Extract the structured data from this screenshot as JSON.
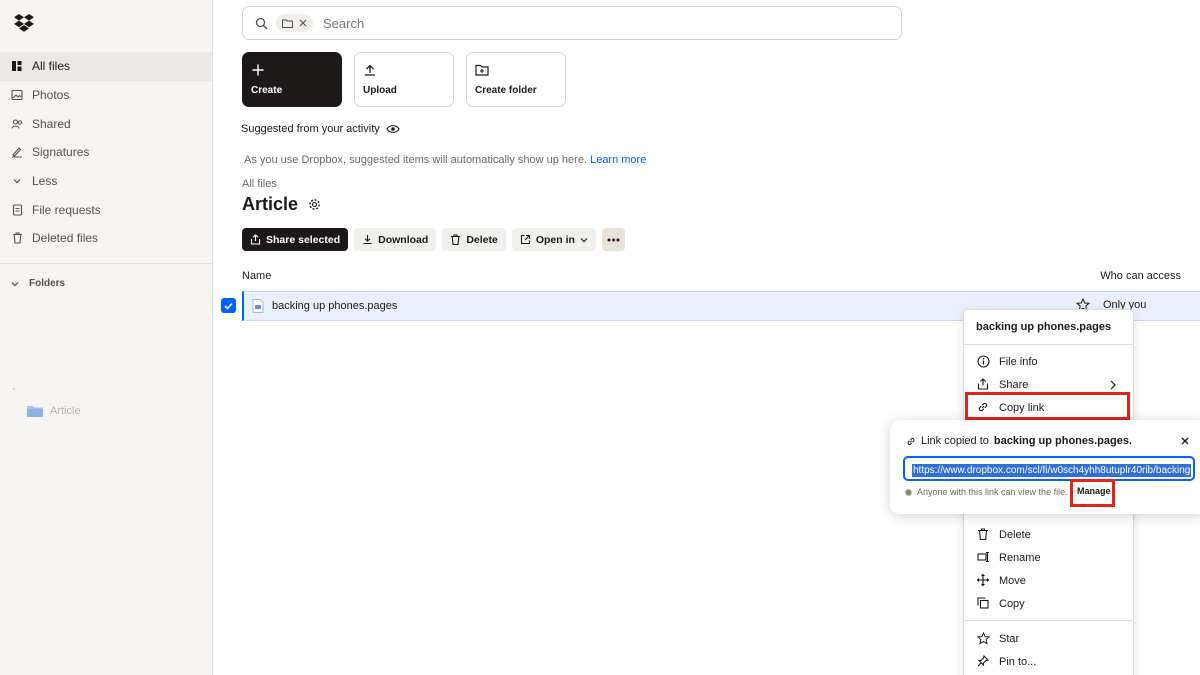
{
  "sidebar": {
    "items": [
      {
        "label": "All files",
        "icon": "all-files-icon"
      },
      {
        "label": "Photos",
        "icon": "photos-icon"
      },
      {
        "label": "Shared",
        "icon": "shared-icon"
      },
      {
        "label": "Signatures",
        "icon": "signatures-icon"
      },
      {
        "label": "Less",
        "icon": "chevron-down-icon"
      },
      {
        "label": "File requests",
        "icon": "file-requests-icon"
      },
      {
        "label": "Deleted files",
        "icon": "trash-icon"
      }
    ],
    "folders_label": "Folders",
    "tree_item": "Article"
  },
  "search": {
    "placeholder": "Search"
  },
  "tiles": {
    "create": "Create",
    "upload": "Upload",
    "create_folder": "Create folder"
  },
  "suggested": {
    "title": "Suggested from your activity",
    "text": "As you use Dropbox, suggested items will automatically show up here.",
    "link": "Learn more"
  },
  "breadcrumb": "All files",
  "page_title": "Article",
  "actions": {
    "share_selected": "Share selected",
    "download": "Download",
    "delete": "Delete",
    "open_in": "Open in"
  },
  "table": {
    "col_name": "Name",
    "col_access": "Who can access",
    "rows": [
      {
        "name": "backing up phones.pages",
        "access": "Only you",
        "selected": true
      }
    ]
  },
  "context_menu": {
    "title": "backing up phones.pages",
    "file_info": "File info",
    "share": "Share",
    "copy_link": "Copy link",
    "delete": "Delete",
    "rename": "Rename",
    "move": "Move",
    "copy": "Copy",
    "star": "Star",
    "pin_to": "Pin to..."
  },
  "popover": {
    "prefix": "Link copied to",
    "filename": "backing up phones.pages.",
    "url": "https://www.dropbox.com/scl/fi/w0sch4yhh8utuplr40rib/backing",
    "note": "Anyone with this link can view the file.",
    "manage": "Manage"
  },
  "colors": {
    "accent": "#0061fe",
    "highlight": "#e1251b",
    "dark": "#1e1919"
  }
}
